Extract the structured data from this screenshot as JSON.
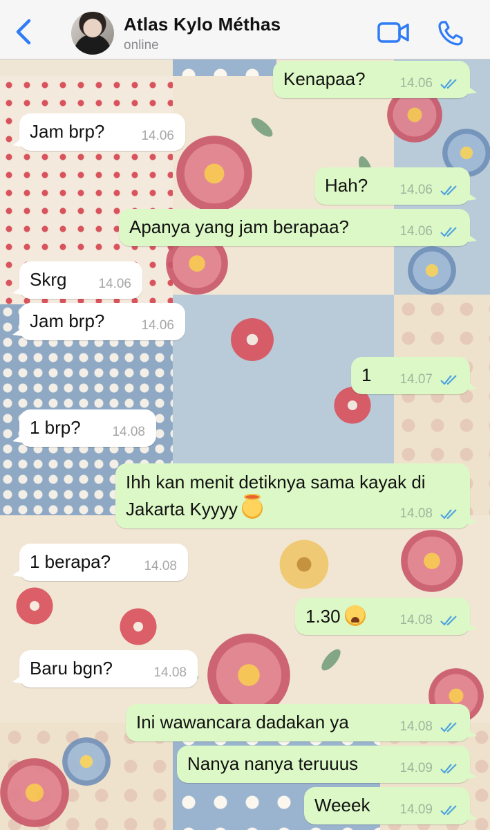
{
  "header": {
    "back_icon": "chevron-left-icon",
    "contact_name": "Atlas Kylo Méthas",
    "status": "online",
    "video_icon": "video-camera-icon",
    "call_icon": "phone-icon",
    "accent_color": "#2f7cf6"
  },
  "messages": [
    {
      "direction": "out",
      "text": "Kenapaa?",
      "time": "14.06",
      "read": true
    },
    {
      "direction": "in",
      "text": "Jam brp?",
      "time": "14.06"
    },
    {
      "direction": "out",
      "text": "Hah?",
      "time": "14.06",
      "read": true
    },
    {
      "direction": "out",
      "text": "Apanya yang jam berapaa?",
      "time": "14.06",
      "read": true
    },
    {
      "direction": "in",
      "text": "Skrg",
      "time": "14.06"
    },
    {
      "direction": "in",
      "text": "Jam brp?",
      "time": "14.06"
    },
    {
      "direction": "out",
      "text": "1",
      "time": "14.07",
      "read": true
    },
    {
      "direction": "in",
      "text": "1 brp?",
      "time": "14.08"
    },
    {
      "direction": "out",
      "text_line1": "Ihh kan menit detiknya sama kayak di",
      "text_line2": "Jakarta Kyyyy",
      "emoji": "exploding-head",
      "time": "14.08",
      "read": true
    },
    {
      "direction": "in",
      "text": "1 berapa?",
      "time": "14.08"
    },
    {
      "direction": "out",
      "text": "1.30",
      "emoji": "weary-face",
      "time": "14.08",
      "read": true
    },
    {
      "direction": "in",
      "text": "Baru bgn?",
      "time": "14.08"
    },
    {
      "direction": "out",
      "text": "Ini wawancara dadakan ya",
      "time": "14.08",
      "read": true
    },
    {
      "direction": "out",
      "text": "Nanya nanya teruuus",
      "time": "14.09",
      "read": true
    },
    {
      "direction": "out",
      "text": "Weeek",
      "time": "14.09",
      "read": true
    }
  ],
  "colors": {
    "incoming_bubble": "#ffffff",
    "outgoing_bubble": "#dcf8c6",
    "read_ticks": "#4fa3e0"
  }
}
